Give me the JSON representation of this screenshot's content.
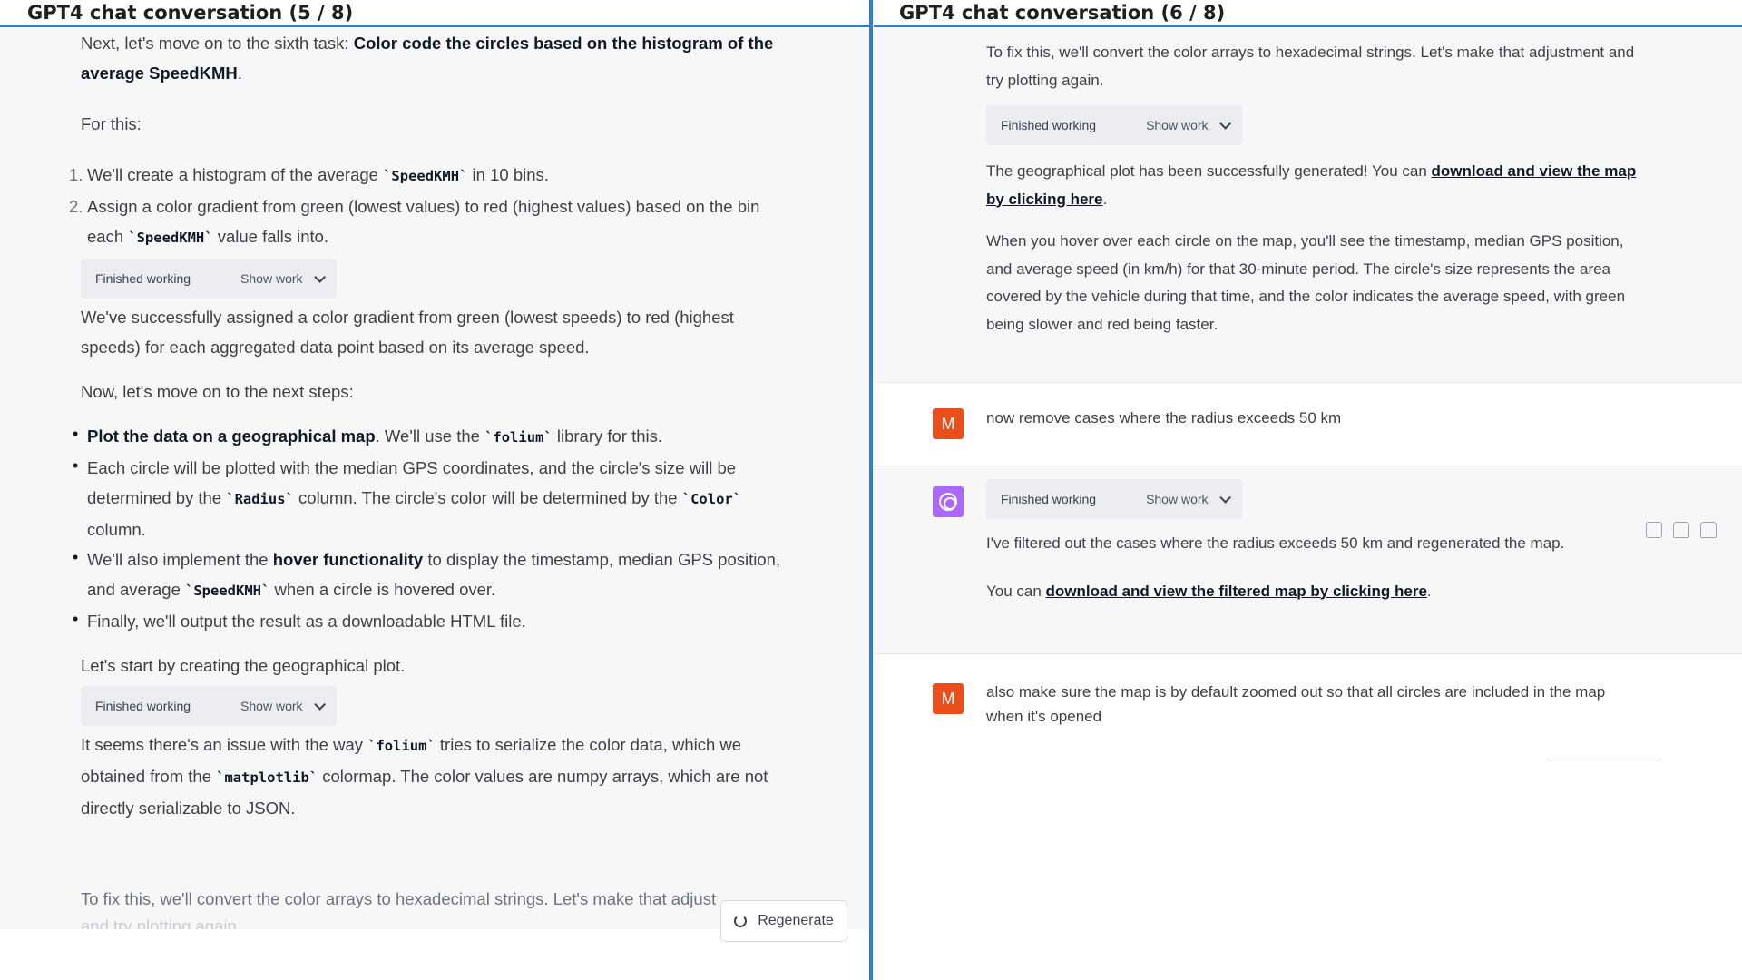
{
  "left": {
    "title": "GPT4 chat conversation (5 / 8)",
    "p1_prefix": "Next, let's move on to the sixth task: ",
    "p1_bold": "Color code the circles based on the histogram of the average SpeedKMH",
    "p1_suffix": ".",
    "for_this": "For this:",
    "steps": [
      {
        "num": "1.",
        "a": "We'll create a histogram of the average ",
        "code": "`SpeedKMH`",
        "b": " in 10 bins."
      },
      {
        "num": "2.",
        "a": "Assign a color gradient from green (lowest values) to red (highest values) based on the bin each ",
        "code": "`SpeedKMH`",
        "b": " value falls into."
      }
    ],
    "work1": {
      "status": "Finished working",
      "toggle": "Show work"
    },
    "p2": "We've successfully assigned a color gradient from green (lowest speeds) to red (highest speeds) for each aggregated data point based on its average speed.",
    "p3": "Now, let's move on to the next steps:",
    "bullets": {
      "b1_bold": "Plot the data on a geographical map",
      "b1_a": ". We'll use the ",
      "b1_code": "`folium`",
      "b1_b": " library for this.",
      "b2_a": "Each circle will be plotted with the median GPS coordinates, and the circle's size will be determined by the ",
      "b2_code1": "`Radius`",
      "b2_b": " column. The circle's color will be determined by the ",
      "b2_code2": "`Color`",
      "b2_c": " column.",
      "b3_a": "We'll also implement the ",
      "b3_bold": "hover functionality",
      "b3_b": " to display the timestamp, median GPS position, and average ",
      "b3_code": "`SpeedKMH`",
      "b3_c": " when a circle is hovered over.",
      "b4": "Finally, we'll output the result as a downloadable HTML file."
    },
    "p4": "Let's start by creating the geographical plot.",
    "work2": {
      "status": "Finished working",
      "toggle": "Show work"
    },
    "p5_a": "It seems there's an issue with the way ",
    "p5_code1": "`folium`",
    "p5_b": " tries to serialize the color data, which we obtained from the ",
    "p5_code2": "`matplotlib`",
    "p5_c": " colormap. The color values are numpy arrays, which are not directly serializable to JSON.",
    "p6": "To fix this, we'll convert the color arrays to hexadecimal strings. Let's make that adjust",
    "p6_cut": "and try plotting again.",
    "regenerate": "Regenerate"
  },
  "right": {
    "title": "GPT4 chat conversation (6 / 8)",
    "m1_p1": "To fix this, we'll convert the color arrays to hexadecimal strings. Let's make that adjustment and try plotting again.",
    "m1_work": {
      "status": "Finished working",
      "toggle": "Show work"
    },
    "m1_p2_a": "The geographical plot has been successfully generated! You can ",
    "m1_p2_link": "download and view the map by clicking here",
    "m1_p2_b": ".",
    "m1_p3": "When you hover over each circle on the map, you'll see the timestamp, median GPS position, and average speed (in km/h) for that 30-minute period. The circle's size represents the area covered by the vehicle during that time, and the color indicates the average speed, with green being slower and red being faster.",
    "u1_avatar": "M",
    "u1_text": "now remove cases where the radius exceeds 50 km",
    "m2_work": {
      "status": "Finished working",
      "toggle": "Show work"
    },
    "m2_p1": "I've filtered out the cases where the radius exceeds 50 km and regenerated the map.",
    "m2_p2_a": "You can ",
    "m2_p2_link": "download and view the filtered map by clicking here",
    "m2_p2_b": ".",
    "u2_avatar": "M",
    "u2_text": "also make sure the map is by default zoomed out so that all circles are included in the map when it's opened"
  }
}
